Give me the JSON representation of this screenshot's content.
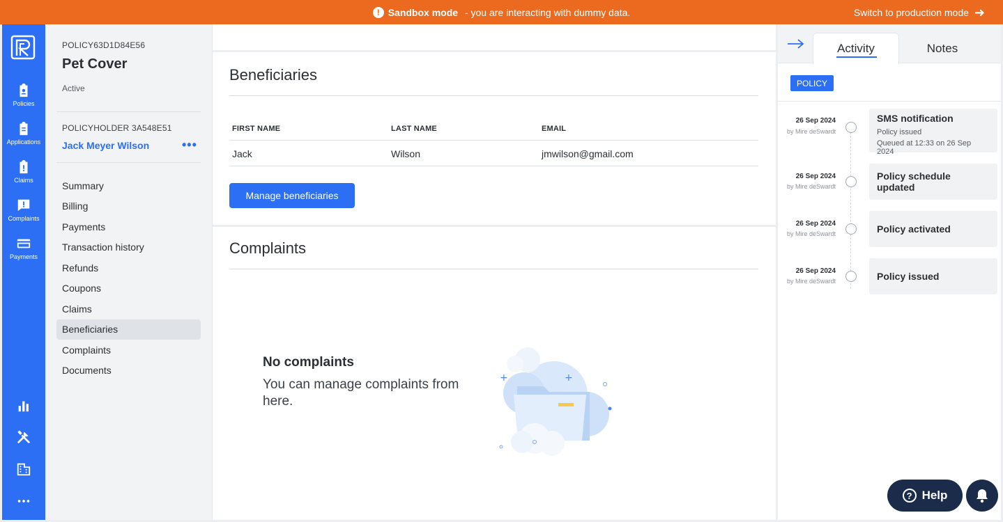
{
  "banner": {
    "mode_label": "Sandbox mode",
    "mode_text": " - you are interacting with dummy data.",
    "switch_label": "Switch to production mode"
  },
  "rail": {
    "items": [
      {
        "label": "Policies",
        "icon": "clipboard-badge-icon"
      },
      {
        "label": "Applications",
        "icon": "clipboard-list-icon"
      },
      {
        "label": "Claims",
        "icon": "clipboard-alert-icon"
      },
      {
        "label": "Complaints",
        "icon": "chat-alert-icon"
      },
      {
        "label": "Payments",
        "icon": "credit-card-icon"
      }
    ],
    "bottom_icons": [
      "bar-chart-icon",
      "tools-icon",
      "building-icon",
      "more-icon"
    ]
  },
  "policy": {
    "id": "POLICY63D1D84E56",
    "name": "Pet Cover",
    "status": "Active",
    "holder_id": "POLICYHOLDER 3A548E51",
    "holder_name": "Jack Meyer Wilson"
  },
  "nav": {
    "items": [
      "Summary",
      "Billing",
      "Payments",
      "Transaction history",
      "Refunds",
      "Coupons",
      "Claims",
      "Beneficiaries",
      "Complaints",
      "Documents"
    ],
    "active": "Beneficiaries"
  },
  "beneficiaries": {
    "title": "Beneficiaries",
    "columns": [
      "FIRST NAME",
      "LAST NAME",
      "EMAIL"
    ],
    "rows": [
      [
        "Jack",
        "Wilson",
        "jmwilson@gmail.com"
      ]
    ],
    "button_label": "Manage beneficiaries"
  },
  "complaints": {
    "title": "Complaints",
    "empty_title": "No complaints",
    "empty_text": "You can manage complaints from here."
  },
  "activity": {
    "tabs": [
      "Activity",
      "Notes"
    ],
    "active_tab": "Activity",
    "filter_badge": "POLICY",
    "events": [
      {
        "date": "26 Sep 2024",
        "by": "by Mire deSwardt",
        "title": "SMS notification",
        "lines": [
          "Policy issued",
          "Queued at 12:33 on 26 Sep 2024"
        ]
      },
      {
        "date": "26 Sep 2024",
        "by": "by Mire deSwardt",
        "title": "Policy schedule updated",
        "lines": []
      },
      {
        "date": "26 Sep 2024",
        "by": "by Mire deSwardt",
        "title": "Policy activated",
        "lines": []
      },
      {
        "date": "26 Sep 2024",
        "by": "by Mire deSwardt",
        "title": "Policy issued",
        "lines": []
      }
    ]
  },
  "floating": {
    "help_label": "Help"
  },
  "colors": {
    "brand_blue": "#2d6ff4",
    "banner_orange": "#ec6a1f",
    "help_navy": "#1b2b4a"
  }
}
